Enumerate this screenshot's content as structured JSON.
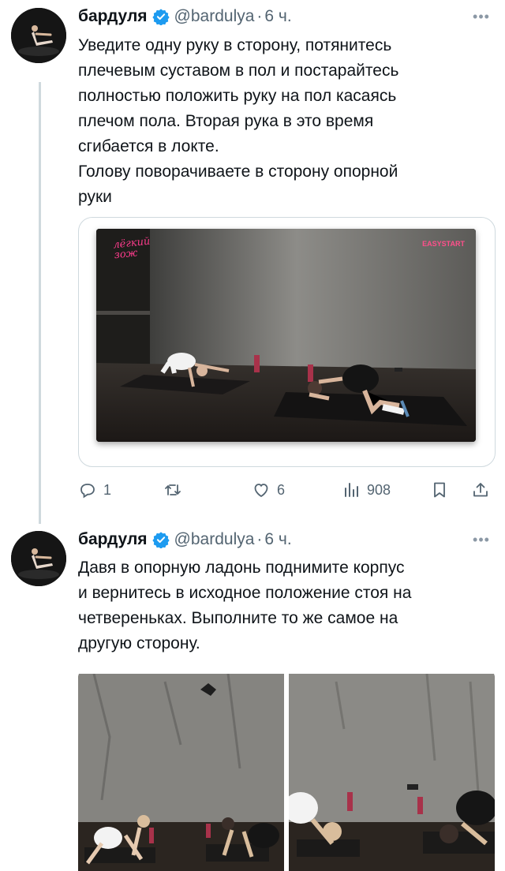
{
  "tweets": [
    {
      "display_name": "бардуля",
      "handle": "@bardulya",
      "separator": "·",
      "time": "6 ч.",
      "text": "Уведите одну руку в сторону, потянитесь\nплечевым суставом в пол и постарайтесь\nполностью положить руку на пол касаясь\nплечом пола. Вторая рука в это время\nсгибается в локте.\nГолову поворачиваете в сторону опорной\nруки",
      "video": {
        "logo_text": "лёгкий\nзож",
        "brand_text": "EASYSTART"
      },
      "actions": {
        "replies": "1",
        "retweets": "",
        "likes": "6",
        "views": "908"
      }
    },
    {
      "display_name": "бардуля",
      "handle": "@bardulya",
      "separator": "·",
      "time": "6 ч.",
      "text": "Давя в опорную ладонь поднимите корпус\nи вернитесь в исходное положение стоя на\nчетвереньках. Выполните то же самое на\nдругую сторону."
    }
  ],
  "icons": {
    "verified": "verified-badge-icon",
    "more": "more-icon",
    "reply": "reply-icon",
    "retweet": "retweet-icon",
    "like": "heart-icon",
    "views": "views-icon",
    "bookmark": "bookmark-icon",
    "share": "share-icon"
  },
  "colors": {
    "text": "#0f1419",
    "secondary": "#536471",
    "verified": "#1d9bf0",
    "border": "#cfd9de"
  }
}
